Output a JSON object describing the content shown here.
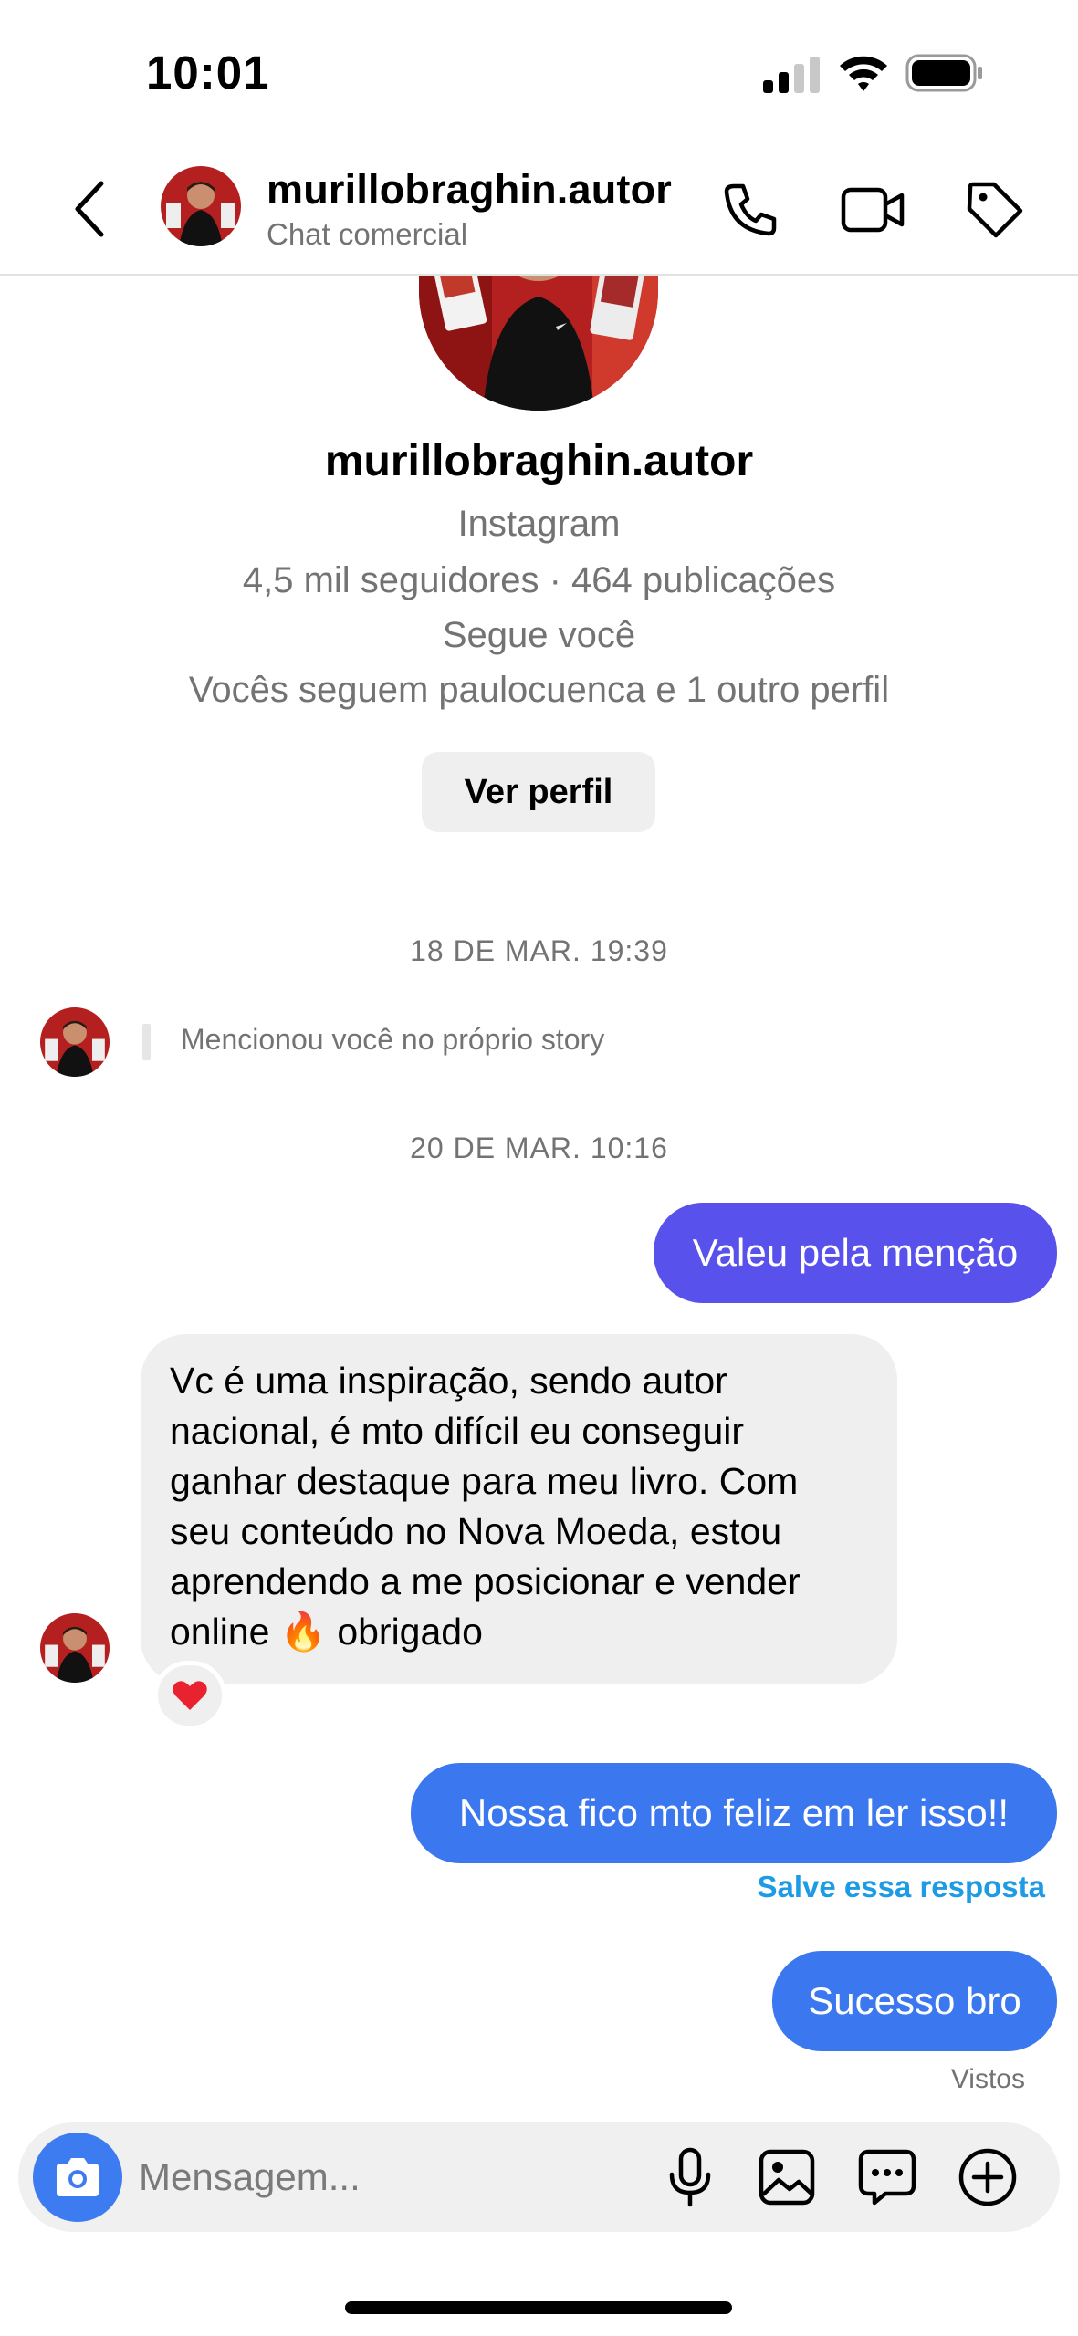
{
  "status_bar": {
    "time": "10:01"
  },
  "header": {
    "username": "murillobraghin.autor",
    "subtitle": "Chat comercial"
  },
  "profile": {
    "name": "murillobraghin.autor",
    "platform": "Instagram",
    "stats": "4,5 mil seguidores · 464 publicações",
    "follows_you": "Segue você",
    "mutual": "Vocês seguem paulocuenca e 1 outro perfil",
    "view_profile_label": "Ver perfil"
  },
  "messages": {
    "date1": "18 DE MAR. 19:39",
    "mention": "Mencionou você no próprio story",
    "date2": "20 DE MAR. 10:16",
    "out1": "Valeu pela menção",
    "in1_lines": [
      "Vc é uma inspiração, sendo autor",
      "nacional, é mto difícil eu conseguir",
      "ganhar destaque para meu livro. Com",
      "seu conteúdo no Nova Moeda, estou",
      "aprendendo a me posicionar e vender"
    ],
    "in1_last_a": "online",
    "in1_emoji": "🔥",
    "in1_last_b": "obrigado",
    "reaction": "❤️",
    "out2": "Nossa fico mto feliz em ler isso!!",
    "save_reply": "Salve essa resposta",
    "out3": "Sucesso bro",
    "seen": "Vistos"
  },
  "composer": {
    "placeholder": "Mensagem..."
  },
  "colors": {
    "bubble_purple": "#5851ec",
    "bubble_blue": "#3b78ef",
    "link_blue": "#1e9be5",
    "camera_blue": "#3d7bf0"
  },
  "icons": [
    "back-arrow-icon",
    "phone-icon",
    "video-icon",
    "tag-icon",
    "camera-icon",
    "microphone-icon",
    "image-icon",
    "sticker-icon",
    "plus-icon"
  ]
}
